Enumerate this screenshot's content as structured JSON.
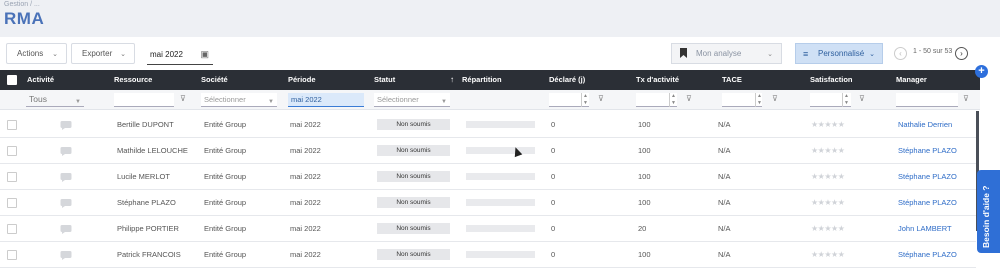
{
  "breadcrumb": "Gestion / ...",
  "page_title": "RMA",
  "toolbar": {
    "actions_label": "Actions",
    "export_label": "Exporter",
    "date_value": "mai 2022",
    "analyse_label": "Mon analyse",
    "personalise_label": "Personnalisé",
    "pager_text": "1 - 50 sur 53"
  },
  "columns": [
    "Activité",
    "Ressource",
    "Société",
    "Période",
    "Statut",
    "Répartition",
    "Déclaré (j)",
    "Tx d'activité",
    "TACE",
    "Satisfaction",
    "Manager"
  ],
  "filters": {
    "activite": "Tous",
    "societe_placeholder": "Sélectionner",
    "periode": "mai 2022",
    "statut_placeholder": "Sélectionner"
  },
  "rows": [
    {
      "ressource": "Bertille DUPONT",
      "societe": "Entité Group",
      "periode": "mai 2022",
      "statut": "Non soumis",
      "declare": "0",
      "tx": "100",
      "tace": "N/A",
      "manager": "Nathalie Derrien"
    },
    {
      "ressource": "Mathilde LELOUCHE",
      "societe": "Entité Group",
      "periode": "mai 2022",
      "statut": "Non soumis",
      "declare": "0",
      "tx": "100",
      "tace": "N/A",
      "manager": "Stéphane PLAZO"
    },
    {
      "ressource": "Lucile MERLOT",
      "societe": "Entité Group",
      "periode": "mai 2022",
      "statut": "Non soumis",
      "declare": "0",
      "tx": "100",
      "tace": "N/A",
      "manager": "Stéphane PLAZO"
    },
    {
      "ressource": "Stéphane PLAZO",
      "societe": "Entité Group",
      "periode": "mai 2022",
      "statut": "Non soumis",
      "declare": "0",
      "tx": "100",
      "tace": "N/A",
      "manager": "Stéphane PLAZO"
    },
    {
      "ressource": "Philippe PORTIER",
      "societe": "Entité Group",
      "periode": "mai 2022",
      "statut": "Non soumis",
      "declare": "0",
      "tx": "20",
      "tace": "N/A",
      "manager": "John LAMBERT"
    },
    {
      "ressource": "Patrick FRANCOIS",
      "societe": "Entité Group",
      "periode": "mai 2022",
      "statut": "Non soumis",
      "declare": "0",
      "tx": "100",
      "tace": "N/A",
      "manager": "Stéphane PLAZO"
    }
  ],
  "stars_text": "★★★★★",
  "help_label": "Besoin d'aide ?",
  "colors": {
    "title": "#4a72b8",
    "header_bg": "#2b2f36",
    "accent": "#2f6fd6",
    "manager_link": "#2e6cc7"
  }
}
